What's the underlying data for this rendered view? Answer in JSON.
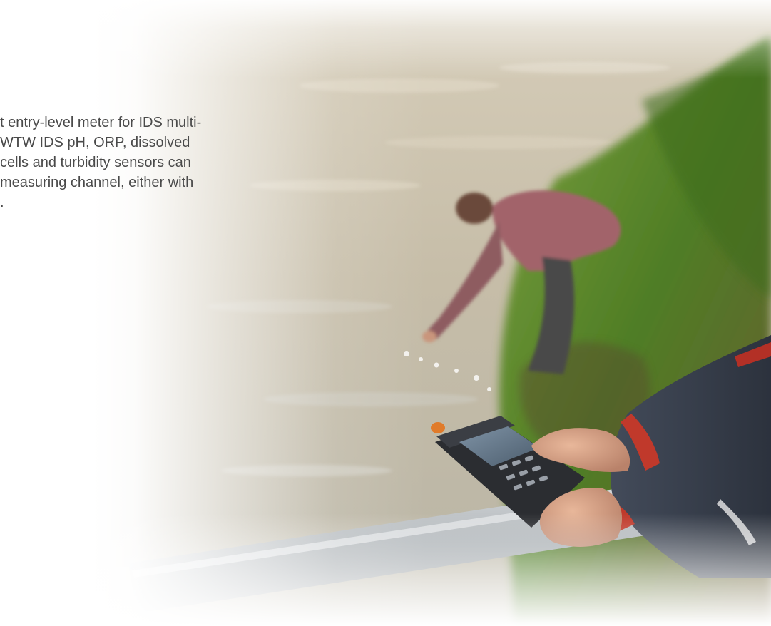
{
  "hero": {
    "image": {
      "icon": "river-water-sampling-photo",
      "colors": {
        "water": "#c9c0ad",
        "grass": "#5f8f2e",
        "jacket": "#3a4150",
        "accent_red": "#c0392b",
        "meter": "#2b2d31",
        "railing": "#a3a8ad"
      }
    },
    "description_lines": [
      "t entry-level meter for IDS multi-",
      "WTW IDS pH, ORP, dissolved",
      "cells and turbidity sensors can",
      " measuring channel, either with",
      "."
    ]
  }
}
